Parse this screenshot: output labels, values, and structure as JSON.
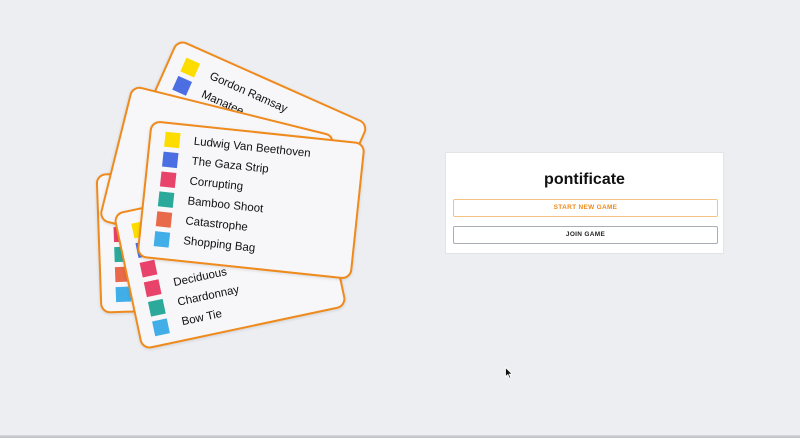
{
  "app": {
    "title": "pontificate",
    "start_label": "START NEW GAME",
    "join_label": "JOIN GAME",
    "accent_color": "#ef8a1c"
  },
  "colors": {
    "yellow": "#fddc00",
    "blue": "#4b6ee3",
    "red": "#e8436a",
    "teal": "#2ba99b",
    "orange": "#e86a4b",
    "sky": "#42aee8"
  },
  "cards": {
    "back_top": {
      "rows": [
        "Gordon Ramsay",
        "Manatee",
        "",
        "",
        "",
        ""
      ]
    },
    "middle_left": {
      "rows": [
        "",
        "",
        "",
        "",
        "",
        ""
      ]
    },
    "lower": {
      "rows": [
        "",
        "",
        "",
        "Deciduous",
        "Chardonnay",
        "Bow Tie"
      ]
    },
    "front": {
      "rows": [
        "Ludwig Van Beethoven",
        "The Gaza Strip",
        "Corrupting",
        "Bamboo Shoot",
        "Catastrophe",
        "Shopping Bag"
      ]
    }
  }
}
